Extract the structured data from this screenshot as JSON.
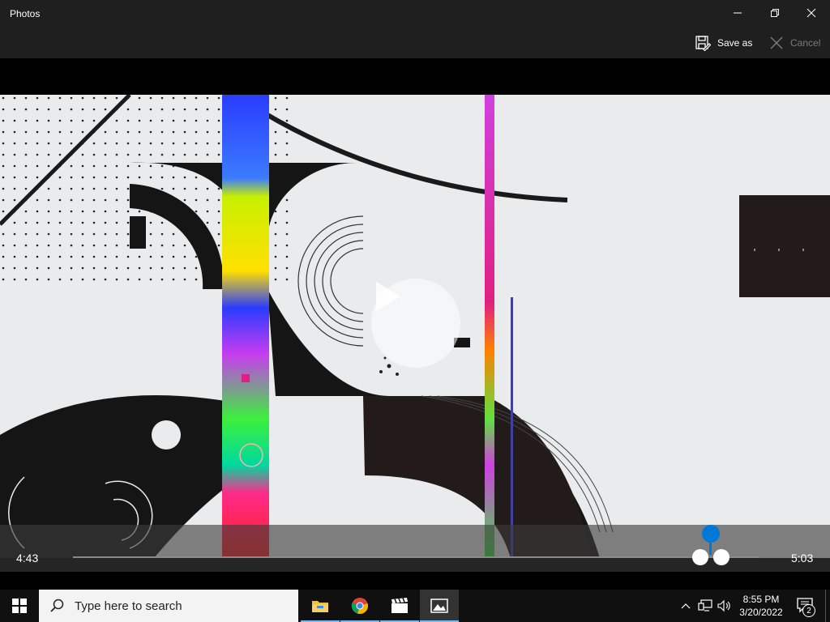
{
  "window": {
    "title": "Photos",
    "minimize_icon": "minimize-icon",
    "restore_icon": "restore-icon",
    "close_icon": "close-icon"
  },
  "commands": {
    "save_as_label": "Save as",
    "save_as_icon": "save-as-icon",
    "cancel_label": "Cancel",
    "cancel_icon": "close-icon"
  },
  "player": {
    "current_time": "4:43",
    "end_time": "5:03",
    "play_icon": "play-icon",
    "trim_start_fraction": 0.911,
    "trim_end_fraction": 0.941,
    "playhead_fraction": 0.926
  },
  "taskbar": {
    "search_placeholder": "Type here to search",
    "apps": [
      {
        "name": "File Explorer",
        "icon": "folder-icon"
      },
      {
        "name": "Google Chrome",
        "icon": "chrome-icon"
      },
      {
        "name": "Video Editor",
        "icon": "clapperboard-icon"
      },
      {
        "name": "Photos",
        "icon": "photos-icon",
        "active": true
      }
    ],
    "clock": {
      "time": "8:55 PM",
      "date": "3/20/2022"
    },
    "notifications_count": "2"
  },
  "colors": {
    "accent": "#0078d7",
    "titlebar": "#1f1f1f",
    "taskbar": "#101010"
  }
}
